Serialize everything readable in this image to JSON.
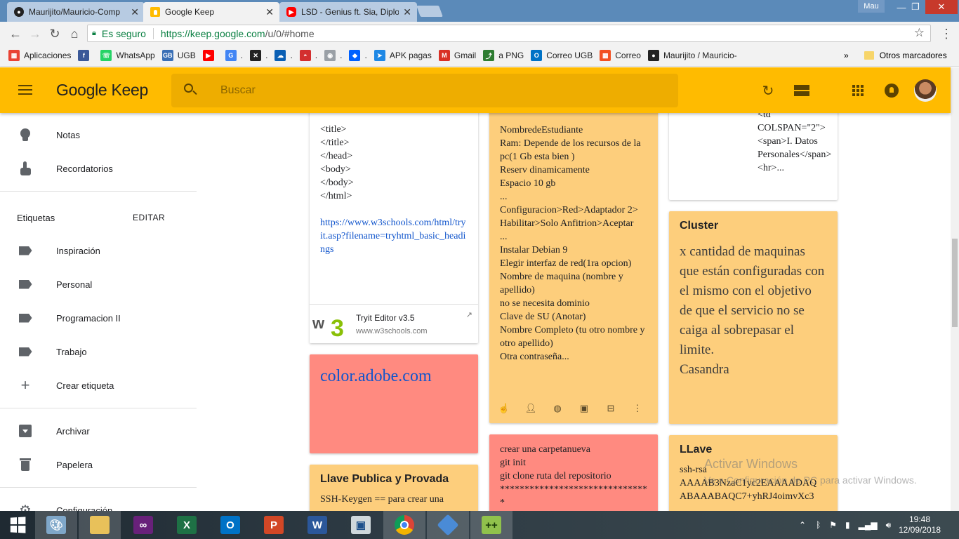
{
  "browser": {
    "tabs": [
      {
        "title": "Maurijito/Mauricio-Comp",
        "favicon": "github-icon"
      },
      {
        "title": "Google Keep",
        "favicon": "keep-icon"
      },
      {
        "title": "LSD - Genius ft. Sia, Diplo",
        "favicon": "youtube-icon"
      }
    ],
    "user": "Mau",
    "secure_label": "Es seguro",
    "url_main": "https://keep.google.com",
    "url_path": "/u/0/#home",
    "bookmarks": [
      {
        "label": "Aplicaciones",
        "icon": "apps-grid-icon",
        "color": "#e94335"
      },
      {
        "label": "",
        "icon": "facebook-icon",
        "color": "#3b5998"
      },
      {
        "label": "WhatsApp",
        "icon": "whatsapp-icon",
        "color": "#25d366"
      },
      {
        "label": "UGB",
        "icon": "ugb-icon",
        "color": "#3a6fb5"
      },
      {
        "label": "",
        "icon": "youtube-icon",
        "color": "#ff0000"
      },
      {
        "label": ".",
        "icon": "translate-icon",
        "color": "#4285f4"
      },
      {
        "label": ".",
        "icon": "x-icon",
        "color": "#222222"
      },
      {
        "label": ".",
        "icon": "onedrive-icon",
        "color": "#0a5fb4"
      },
      {
        "label": ".",
        "icon": "pokeball-icon",
        "color": "#d32f2f"
      },
      {
        "label": ".",
        "icon": "chrome-icon",
        "color": "#9aa0a6"
      },
      {
        "label": ".",
        "icon": "dropbox-icon",
        "color": "#0061ff"
      },
      {
        "label": "APK pagas",
        "icon": "apk-icon",
        "color": "#1e88e5"
      },
      {
        "label": "Gmail",
        "icon": "gmail-icon",
        "color": "#d93025"
      },
      {
        "label": "a PNG",
        "icon": "convert-icon",
        "color": "#2e7d32"
      },
      {
        "label": "Correo UGB",
        "icon": "outlook-icon",
        "color": "#0072c6"
      },
      {
        "label": "Correo",
        "icon": "microsoft-icon",
        "color": "#f25022"
      },
      {
        "label": "Maurijito / Mauricio-",
        "icon": "github-icon",
        "color": "#222222"
      }
    ],
    "bookmarks_more": "»",
    "other_bookmarks": "Otros marcadores"
  },
  "keep": {
    "brand_google": "Google",
    "brand_keep": "Keep",
    "search_placeholder": "Buscar",
    "accent": "#ffbb00",
    "sidebar": {
      "primary": [
        {
          "label": "Notas",
          "icon": "lightbulb-icon"
        },
        {
          "label": "Recordatorios",
          "icon": "reminder-hand-icon"
        }
      ],
      "labels_heading": "Etiquetas",
      "edit_label": "EDITAR",
      "labels": [
        "Inspiración",
        "Personal",
        "Programacion II",
        "Trabajo"
      ],
      "create_label": "Crear etiqueta",
      "archive": "Archivar",
      "trash": "Papelera",
      "settings": "Configuración"
    },
    "notes": {
      "html_note": {
        "text": "<title>\n</title>\n</head>\n<body>\n</body>\n</html>",
        "link": "https://www.w3schools.com/html/tryit.asp?filename=tryhtml_basic_headings",
        "link_title": "Tryit Editor v3.5",
        "link_domain": "www.w3schools.com"
      },
      "adobe_note": {
        "link": "color.adobe.com"
      },
      "llave_note": {
        "title": "Llave Publica y Provada",
        "text": "SSH-Keygen == para crear una"
      },
      "vm_note": {
        "text": "NombredeEstudiante\nRam: Depende de los recursos de la pc(1 Gb esta bien )\nReserv dinamicamente\nEspacio 10 gb\n...\nConfiguracion>Red>Adaptador 2> Habilitar>Solo Anfitrion>Aceptar\n...\nInstalar Debian 9\nElegir interfaz de red(1ra opcion)\nNombre de maquina (nombre y apellido)\nno se necesita dominio\nClave de SU (Anotar)\nNombre Completo (tu otro nombre y otro apellido)\nOtra contraseña..."
      },
      "git_note": {
        "text": "crear una carpetanueva\ngit init\ngit clone ruta del repositorio\n*******************************\n*******************************"
      },
      "table_note": {
        "text": "<td\nCOLSPAN=\"2\">\n<span>I.\nDatos Personales</span><hr>..."
      },
      "cluster_note": {
        "title": "Cluster",
        "text": "x cantidad de maquinas que están configuradas con el mismo con el objetivo de que el servicio no se caiga al sobrepasar el limite.\nCasandra"
      },
      "llave2_note": {
        "title": "LLave",
        "text": "ssh-rsa\nAAAAB3NzaC1yc2EAAAADAQ\nABAAABAQC7+yhRJ4oimvXc3"
      }
    }
  },
  "windows": {
    "watermark_title": "Activar Windows",
    "watermark_text": "Ve a Configuración de PC para activar Windows.",
    "time": "19:48",
    "date": "12/09/2018"
  }
}
